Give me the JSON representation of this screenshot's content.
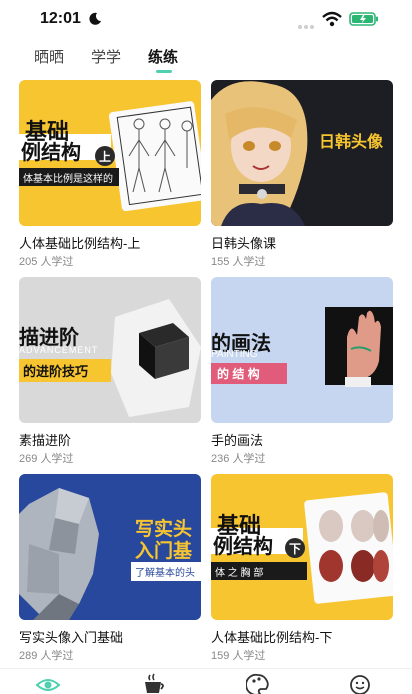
{
  "status": {
    "time": "12:01"
  },
  "tabs": [
    {
      "label": "晒晒"
    },
    {
      "label": "学学"
    },
    {
      "label": "练练"
    }
  ],
  "courses": [
    {
      "title": "人体基础比例结构-上",
      "learners": "205 人学过",
      "thumb_lines": [
        "基础",
        "例结构",
        "上",
        "体基本比例是这样的"
      ]
    },
    {
      "title": "日韩头像课",
      "learners": "155 人学过",
      "thumb_lines": [
        "日韩头像"
      ]
    },
    {
      "title": "素描进阶",
      "learners": "269 人学过",
      "thumb_lines": [
        "描进阶",
        "ADVANCEMENT",
        "的进阶技巧"
      ]
    },
    {
      "title": "手的画法",
      "learners": "236 人学过",
      "thumb_lines": [
        "的画法",
        "PAINTING",
        "的 结 构"
      ]
    },
    {
      "title": "写实头像入门基础",
      "learners": "289 人学过",
      "thumb_lines": [
        "写实头",
        "入门基",
        "了解基本的头"
      ]
    },
    {
      "title": "人体基础比例结构-下",
      "learners": "159 人学过",
      "thumb_lines": [
        "基础",
        "例结构",
        "下",
        "体 之 胸 部"
      ]
    }
  ],
  "bottom_nav": [
    {
      "icon": "eye-icon"
    },
    {
      "icon": "cup-icon"
    },
    {
      "icon": "palette-icon"
    },
    {
      "icon": "smile-icon"
    }
  ],
  "colors": {
    "accent": "#4fd1b0",
    "thumb_yellow": "#f7c530",
    "thumb_blue": "#27489c"
  }
}
